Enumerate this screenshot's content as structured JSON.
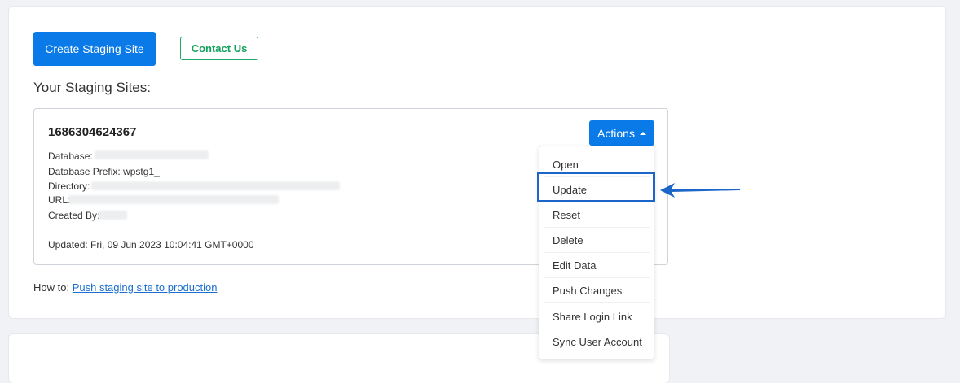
{
  "toolbar": {
    "create_label": "Create Staging Site",
    "contact_label": "Contact Us"
  },
  "section_title": "Your Staging Sites:",
  "site": {
    "id": "1686304624367",
    "database_label": "Database:",
    "prefix_label": "Database Prefix:",
    "prefix_value": "wpstg1_",
    "directory_label": "Directory:",
    "url_label": "URL:",
    "created_by_label": "Created By:",
    "updated": "Updated: Fri, 09 Jun 2023 10:04:41 GMT+0000"
  },
  "actions": {
    "label": "Actions",
    "items": [
      "Open",
      "Update",
      "Reset",
      "Delete",
      "Edit Data",
      "Push Changes",
      "Share Login Link",
      "Sync User Account"
    ],
    "highlighted": "Update"
  },
  "howto": {
    "prefix": "How to:",
    "link": "Push staging site to production"
  },
  "colors": {
    "primary": "#0a7ae8",
    "contact_green": "#1fa866",
    "highlight": "#1c66c9"
  }
}
